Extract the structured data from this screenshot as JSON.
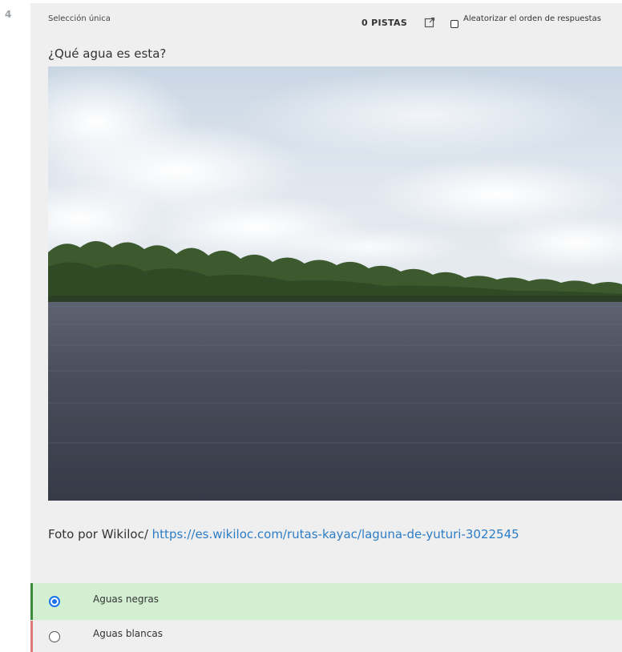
{
  "question": {
    "number": "4",
    "type_label": "Selección única",
    "hints_label": "0 PISTAS",
    "shuffle_label": "Aleatorizar el orden de respuestas",
    "shuffle_checked": false,
    "text": "¿Qué agua es esta?",
    "image_icon": "photo-lake-rainforest",
    "caption_prefix": "Foto por Wikiloc/ ",
    "caption_link": "https://es.wikiloc.com/rutas-kayac/laguna-de-yuturi-3022545"
  },
  "answers": [
    {
      "label": "Aguas negras",
      "selected": true,
      "status": "correct"
    },
    {
      "label": "Aguas blancas",
      "selected": false,
      "status": "incorrect"
    }
  ],
  "colors": {
    "card_bg": "#efefef",
    "correct_bg": "#d3efd1",
    "correct_border": "#3c8b3c",
    "wrong_border": "#e07a7a",
    "link": "#2d7dc6",
    "radio_selected": "#1a73e8"
  }
}
